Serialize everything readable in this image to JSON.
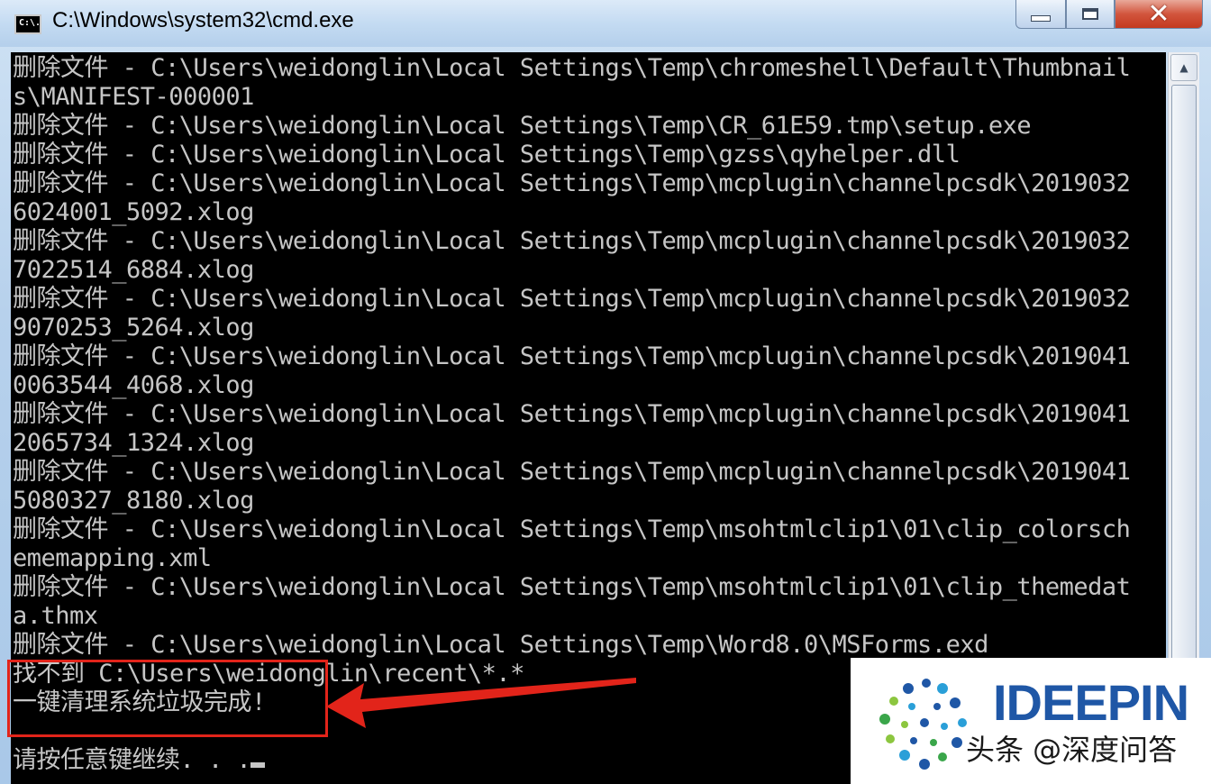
{
  "window": {
    "title": "C:\\Windows\\system32\\cmd.exe",
    "icon_text": "C:\\."
  },
  "console": {
    "lines": [
      "删除文件 - C:\\Users\\weidonglin\\Local Settings\\Temp\\chromeshell\\Default\\Thumbnail",
      "s\\MANIFEST-000001",
      "删除文件 - C:\\Users\\weidonglin\\Local Settings\\Temp\\CR_61E59.tmp\\setup.exe",
      "删除文件 - C:\\Users\\weidonglin\\Local Settings\\Temp\\gzss\\qyhelper.dll",
      "删除文件 - C:\\Users\\weidonglin\\Local Settings\\Temp\\mcplugin\\channelpcsdk\\2019032",
      "6024001_5092.xlog",
      "删除文件 - C:\\Users\\weidonglin\\Local Settings\\Temp\\mcplugin\\channelpcsdk\\2019032",
      "7022514_6884.xlog",
      "删除文件 - C:\\Users\\weidonglin\\Local Settings\\Temp\\mcplugin\\channelpcsdk\\2019032",
      "9070253_5264.xlog",
      "删除文件 - C:\\Users\\weidonglin\\Local Settings\\Temp\\mcplugin\\channelpcsdk\\2019041",
      "0063544_4068.xlog",
      "删除文件 - C:\\Users\\weidonglin\\Local Settings\\Temp\\mcplugin\\channelpcsdk\\2019041",
      "2065734_1324.xlog",
      "删除文件 - C:\\Users\\weidonglin\\Local Settings\\Temp\\mcplugin\\channelpcsdk\\2019041",
      "5080327_8180.xlog",
      "删除文件 - C:\\Users\\weidonglin\\Local Settings\\Temp\\msohtmlclip1\\01\\clip_colorsch",
      "ememapping.xml",
      "删除文件 - C:\\Users\\weidonglin\\Local Settings\\Temp\\msohtmlclip1\\01\\clip_themedat",
      "a.thmx",
      "删除文件 - C:\\Users\\weidonglin\\Local Settings\\Temp\\Word8.0\\MSForms.exd",
      "找不到 C:\\Users\\weidonglin\\recent\\*.*",
      "一键清理系统垃圾完成!",
      "",
      "请按任意键继续. . ."
    ]
  },
  "watermark": {
    "brand": "IDEEPIN",
    "caption": "头条 @深度问答"
  },
  "colors": {
    "console_bg": "#000000",
    "console_text": "#c6c6c6",
    "annotation_red": "#e2241a",
    "brand_blue": "#1f57a6",
    "close_button_red": "#c4391f"
  },
  "icons": [
    "cmd-app-icon",
    "minimize-icon",
    "maximize-icon",
    "close-icon",
    "scroll-up-icon",
    "annotation-arrow",
    "ideepin-logo"
  ]
}
